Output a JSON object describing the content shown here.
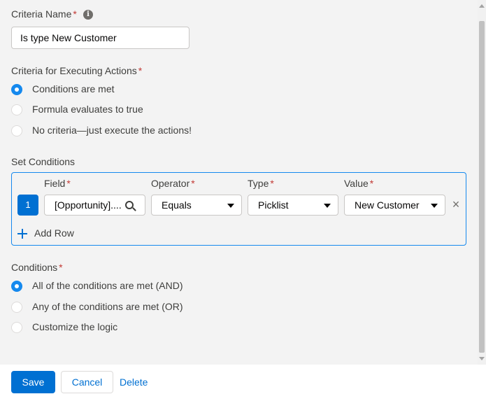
{
  "criteria_name": {
    "label": "Criteria Name",
    "required_mark": "*",
    "value": "Is type New Customer"
  },
  "executing_actions": {
    "label": "Criteria for Executing Actions",
    "required_mark": "*",
    "options": [
      {
        "label": "Conditions are met",
        "checked": true
      },
      {
        "label": "Formula evaluates to true",
        "checked": false
      },
      {
        "label": "No criteria—just execute the actions!",
        "checked": false
      }
    ]
  },
  "set_conditions": {
    "label": "Set Conditions",
    "columns": {
      "field": "Field",
      "operator": "Operator",
      "type": "Type",
      "value": "Value",
      "required_mark": "*"
    },
    "rows": [
      {
        "number": "1",
        "field": "[Opportunity]....",
        "operator": "Equals",
        "type": "Picklist",
        "value": "New Customer"
      }
    ],
    "add_row_label": "Add Row"
  },
  "conditions": {
    "label": "Conditions",
    "required_mark": "*",
    "options": [
      {
        "label": "All of the conditions are met (AND)",
        "checked": true
      },
      {
        "label": "Any of the conditions are met (OR)",
        "checked": false
      },
      {
        "label": "Customize the logic",
        "checked": false
      }
    ]
  },
  "footer": {
    "save": "Save",
    "cancel": "Cancel",
    "delete": "Delete"
  },
  "colors": {
    "brand": "#0070d2",
    "radio_checked": "#1589ee",
    "required": "#c23934",
    "panel_bg": "#f3f3f3"
  },
  "icons": [
    "info-icon",
    "search-icon",
    "chevron-down-icon",
    "close-icon",
    "plus-icon"
  ]
}
